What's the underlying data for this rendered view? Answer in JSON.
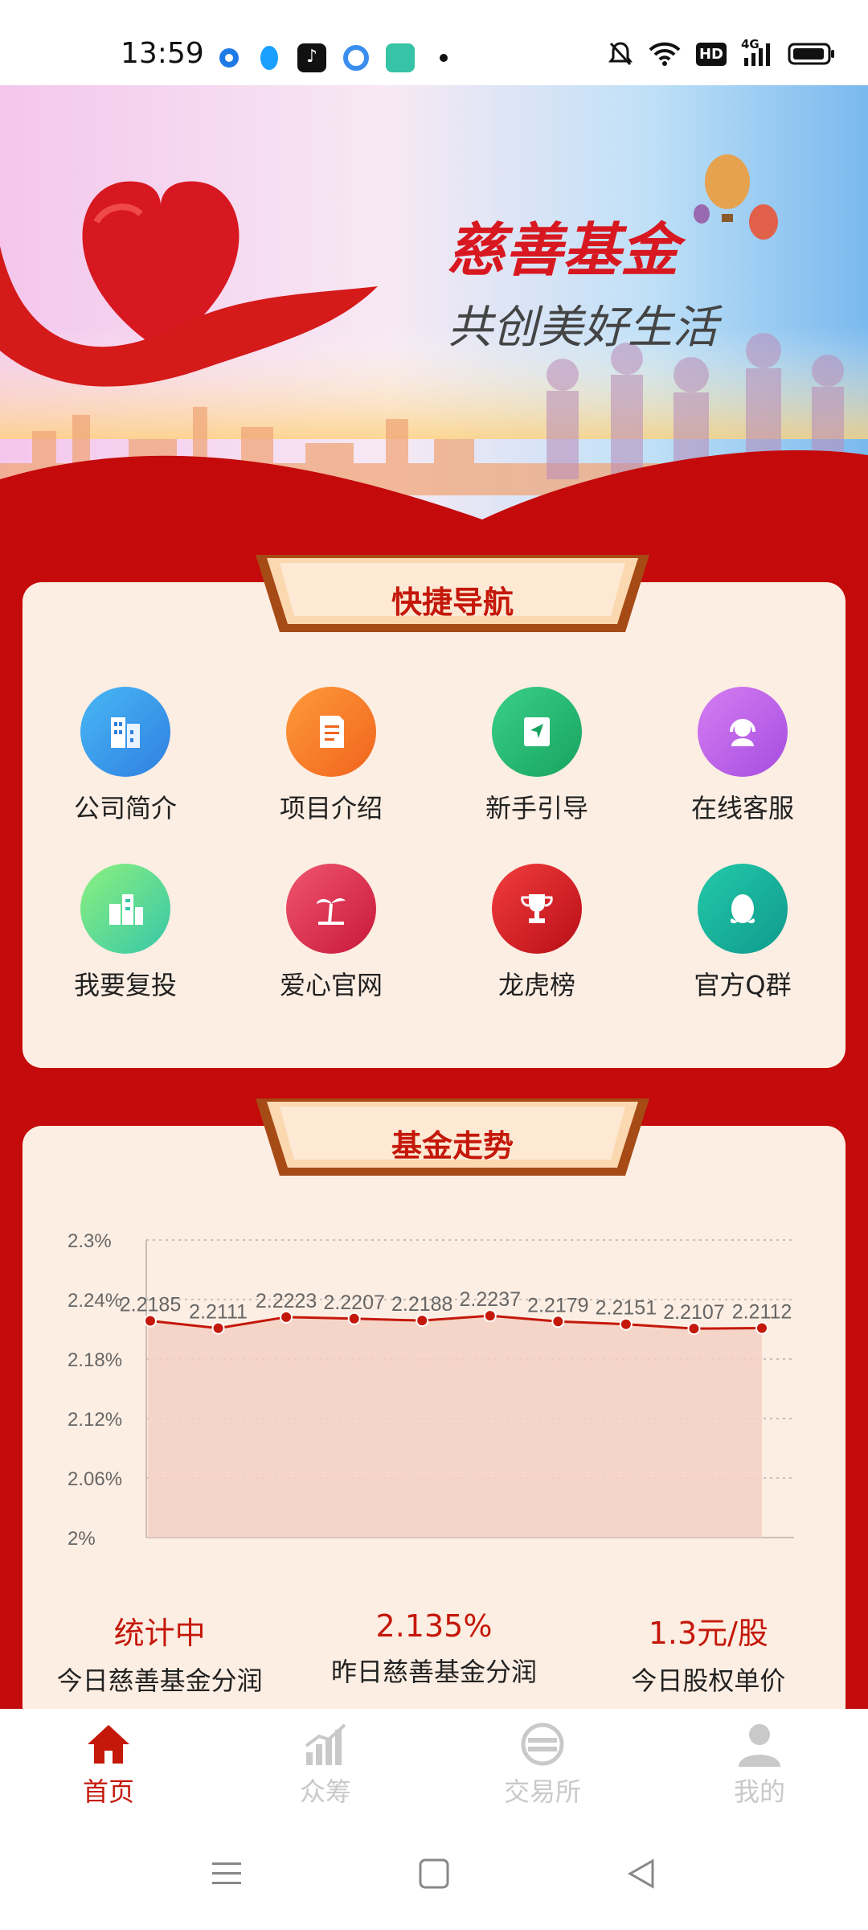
{
  "status_bar": {
    "time": "13:59",
    "apps": [
      {
        "icon": "app-blue-ring-icon",
        "color": "#1e7be6"
      },
      {
        "icon": "qq-penguin-icon",
        "color": "#1aa0ff"
      },
      {
        "icon": "douyin-icon",
        "color": "#111111"
      },
      {
        "icon": "app-swirl-icon",
        "color": "#3b8ef0"
      },
      {
        "icon": "app-teal-icon",
        "color": "#36c3a6"
      }
    ],
    "right_icons": [
      "mute-bell-icon",
      "wifi-icon",
      "hd-icon",
      "cellular-4g-icon",
      "battery-icon"
    ],
    "hd_label": "HD",
    "net_label": "4G"
  },
  "banner": {
    "title": "慈善基金",
    "slogan": "共创美好生活"
  },
  "quick_nav": {
    "title": "快捷导航",
    "items": [
      {
        "label": "公司简介",
        "icon": "building-icon",
        "color_from": "#49b8f5",
        "color_to": "#2f7fe0"
      },
      {
        "label": "项目介绍",
        "icon": "document-icon",
        "color_from": "#ff9a3a",
        "color_to": "#f0641d"
      },
      {
        "label": "新手引导",
        "icon": "guide-book-icon",
        "color_from": "#3bd08a",
        "color_to": "#17a35f"
      },
      {
        "label": "在线客服",
        "icon": "headset-icon",
        "color_from": "#d67df2",
        "color_to": "#a54de0"
      },
      {
        "label": "我要复投",
        "icon": "buildings-icon",
        "color_from": "#8df07e",
        "color_to": "#37c7a9"
      },
      {
        "label": "爱心官网",
        "icon": "palm-tree-icon",
        "color_from": "#f0566f",
        "color_to": "#c8183a"
      },
      {
        "label": "龙虎榜",
        "icon": "trophy-icon",
        "color_from": "#f23d3d",
        "color_to": "#b80e17"
      },
      {
        "label": "官方Q群",
        "icon": "qq-penguin-icon",
        "color_from": "#23c9a9",
        "color_to": "#0f9a8d"
      }
    ]
  },
  "fund_trend": {
    "title": "基金走势",
    "stats": [
      {
        "value": "统计中",
        "label": "今日慈善基金分润"
      },
      {
        "value": "2.135%",
        "label": "昨日慈善基金分润"
      },
      {
        "value": "1.3元/股",
        "label": "今日股权单价"
      }
    ]
  },
  "chart_data": {
    "type": "area",
    "title": "",
    "xlabel": "",
    "ylabel": "",
    "ylim": [
      2.0,
      2.3
    ],
    "y_ticks": [
      "2.3%",
      "2.24%",
      "2.18%",
      "2.12%",
      "2.06%",
      "2%"
    ],
    "grid": true,
    "values": [
      2.2185,
      2.2111,
      2.2223,
      2.2207,
      2.2188,
      2.2237,
      2.2179,
      2.2151,
      2.2107,
      2.2112
    ],
    "labels": [
      "2.2185",
      "2.2111",
      "2.2223",
      "2.2207",
      "2.2188",
      "2.2237",
      "2.2179",
      "2.2151",
      "2.2107",
      "2.2112"
    ],
    "line_color": "#c4180a",
    "fill_color": "#f5d0c4"
  },
  "tabbar": {
    "tabs": [
      {
        "label": "首页",
        "icon": "home-icon",
        "active": true
      },
      {
        "label": "众筹",
        "icon": "bar-chart-icon",
        "active": false
      },
      {
        "label": "交易所",
        "icon": "exchange-icon",
        "active": false
      },
      {
        "label": "我的",
        "icon": "user-icon",
        "active": false
      }
    ],
    "active_color": "#c4180a",
    "inactive_color": "#c9c9c9"
  },
  "system_nav": [
    "menu-icon",
    "home-square-icon",
    "back-icon"
  ]
}
